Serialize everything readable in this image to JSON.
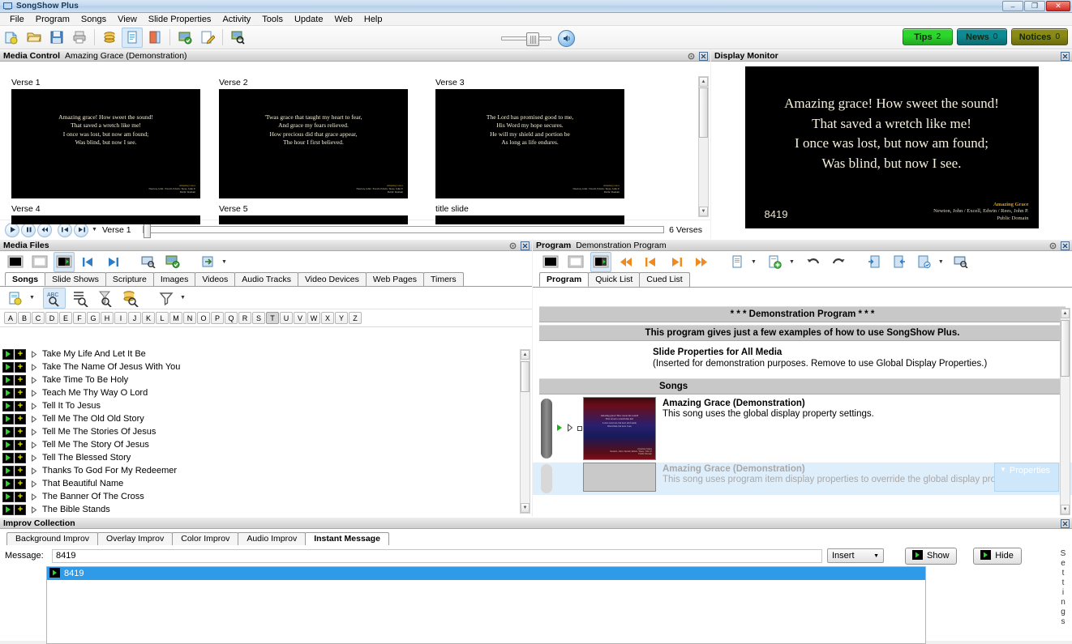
{
  "window": {
    "title": "SongShow Plus",
    "minimize": "–",
    "maximize": "❐",
    "close": "✕"
  },
  "menu": [
    "File",
    "Program",
    "Songs",
    "View",
    "Slide Properties",
    "Activity",
    "Tools",
    "Update",
    "Web",
    "Help"
  ],
  "toolbar": {
    "buttons": [
      "new-icon",
      "open-icon",
      "save-icon",
      "print-icon",
      "database-icon",
      "document-icon",
      "exit-icon",
      "media-add-icon",
      "edit-icon",
      "media-search-icon"
    ],
    "volume_icon": "volume-slider",
    "sound_icon": "sound-icon"
  },
  "corner_buttons": [
    {
      "label": "Tips",
      "count": "2",
      "color": "#2cd62c"
    },
    {
      "label": "News",
      "count": "0",
      "color": "#0e8a93"
    },
    {
      "label": "Notices",
      "count": "0",
      "color": "#8a8a14"
    }
  ],
  "media_control": {
    "title": "Media Control",
    "subtitle": "Amazing Grace (Demonstration)",
    "slides": [
      {
        "label": "Verse 1",
        "lines": [
          "Amazing grace! How sweet the sound!",
          "That saved a wretch like me!",
          "I once was lost, but now am found;",
          "Was blind, but now I see."
        ]
      },
      {
        "label": "Verse 2",
        "lines": [
          "'Twas grace that taught my heart to fear,",
          "And grace my fears relieved.",
          "How precious did that grace appear,",
          "The hour I first believed."
        ]
      },
      {
        "label": "Verse 3",
        "lines": [
          "The Lord has promised good to me,",
          "His Word my hope secures.",
          "He will my shield and portion be",
          "As long as life endures."
        ]
      },
      {
        "label": "Verse 4",
        "lines": []
      },
      {
        "label": "Verse 5",
        "lines": []
      },
      {
        "label": "title slide",
        "lines": []
      }
    ],
    "credit": {
      "title": "Amazing Grace",
      "authors": "Newton, John / Excell, Edwin / Rees, John P.",
      "rights": "Public Domain"
    },
    "transport": {
      "play": "play-icon",
      "pause": "pause-icon",
      "rewind": "rewind-icon",
      "prev": "prev-slide-icon",
      "next": "next-slide-icon",
      "dropdown": "chevron-down-icon"
    },
    "current_slide": "Verse 1",
    "slide_count": "6 Verses"
  },
  "display_monitor": {
    "title": "Display Monitor",
    "lyrics": [
      "Amazing grace! How sweet the sound!",
      "That saved a wretch like me!",
      "I once was lost, but now am found;",
      "Was blind, but now I see."
    ],
    "number": "8419",
    "credit": {
      "title": "Amazing Grace",
      "authors": "Newton, John / Excell, Edwin / Rees, John P.",
      "rights": "Public Domain"
    }
  },
  "media_files": {
    "title": "Media Files",
    "toolbar": [
      "black-screen-icon",
      "white-screen-icon",
      "logo-screen-icon",
      "prev-icon",
      "next-icon",
      "preview-icon",
      "media-check-icon",
      "import-icon"
    ],
    "tabs": [
      {
        "label": "Songs",
        "active": true
      },
      {
        "label": "Slide Shows",
        "active": false
      },
      {
        "label": "Scripture",
        "active": false
      },
      {
        "label": "Images",
        "active": false
      },
      {
        "label": "Videos",
        "active": false
      },
      {
        "label": "Audio Tracks",
        "active": false
      },
      {
        "label": "Video Devices",
        "active": false
      },
      {
        "label": "Web Pages",
        "active": false
      },
      {
        "label": "Timers",
        "active": false
      }
    ],
    "toolbar2": [
      "new-song-icon",
      "alpha-search-icon",
      "lyrics-search-icon",
      "topic-search-icon",
      "database-search-icon",
      "filter-icon"
    ],
    "alphabet": [
      "A",
      "B",
      "C",
      "D",
      "E",
      "F",
      "G",
      "H",
      "I",
      "J",
      "K",
      "L",
      "M",
      "N",
      "O",
      "P",
      "Q",
      "R",
      "S",
      "T",
      "U",
      "V",
      "W",
      "X",
      "Y",
      "Z"
    ],
    "selected_letter": "T",
    "songs": [
      "Take My Life And Let It Be",
      "Take The Name Of Jesus With You",
      "Take Time To Be Holy",
      "Teach Me Thy Way O Lord",
      "Tell It To Jesus",
      "Tell Me The Old Old Story",
      "Tell Me The Stories Of Jesus",
      "Tell Me The Story Of Jesus",
      "Tell The Blessed Story",
      "Thanks To God For My Redeemer",
      "That Beautiful Name",
      "The Banner Of The Cross",
      "The Bible Stands"
    ]
  },
  "program": {
    "title": "Program",
    "subtitle": "Demonstration Program",
    "toolbar": [
      "black-screen-icon",
      "white-screen-icon",
      "logo-screen-icon",
      "first-icon",
      "prev-icon",
      "next-icon",
      "last-icon",
      "new-program-icon",
      "add-item-icon",
      "undo-icon",
      "redo-icon",
      "insert-before-icon",
      "insert-after-icon",
      "save-as-icon",
      "preview-icon"
    ],
    "tabs": [
      {
        "label": "Program",
        "active": true
      },
      {
        "label": "Quick List",
        "active": false
      },
      {
        "label": "Cued List",
        "active": false
      }
    ],
    "header_bar": "* * * Demonstration Program * * *",
    "subheader_bar": "This program gives just a few examples of how to use SongShow Plus.",
    "note": {
      "title": "Slide Properties for All Media",
      "body": "(Inserted for demonstration purposes.  Remove to use Global Display Properties.)"
    },
    "section_bar": "Songs",
    "items": [
      {
        "title": "Amazing Grace (Demonstration)",
        "desc": "This song uses the global display property settings.",
        "dim": false,
        "mini_lines": [
          "Amazing grace! How sweet the sound!",
          "That saved a wretch like me!",
          "I once was lost, but now am found;",
          "Was blind, but now I see."
        ],
        "mini_credit": [
          "Amazing Grace",
          "Newton, John / Excell, Edwin / Rees, John P.",
          "Public Domain"
        ]
      },
      {
        "title": "Amazing Grace (Demonstration)",
        "desc": "This song uses program item display properties to override the global display prop",
        "dim": true,
        "mini_lines": [],
        "mini_credit": []
      }
    ],
    "properties_tag": "Properties"
  },
  "improv": {
    "title": "Improv Collection",
    "tabs": [
      {
        "label": "Background Improv",
        "active": false
      },
      {
        "label": "Overlay Improv",
        "active": false
      },
      {
        "label": "Color Improv",
        "active": false
      },
      {
        "label": "Audio Improv",
        "active": false
      },
      {
        "label": "Instant Message",
        "active": true
      }
    ],
    "message_label": "Message:",
    "message_value": "8419",
    "message_placeholder": "",
    "insert_label": "Insert",
    "show_label": "Show",
    "hide_label": "Hide",
    "list_items": [
      "8419"
    ],
    "settings_rail": "Settings"
  }
}
